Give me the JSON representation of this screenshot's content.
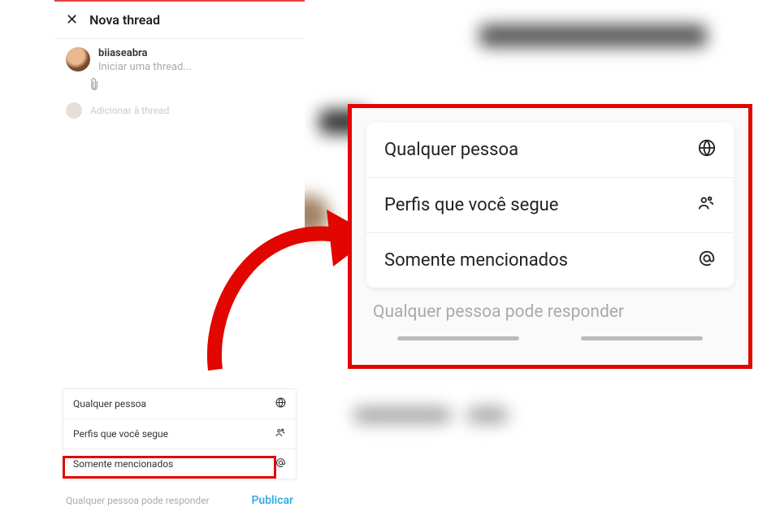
{
  "header": {
    "title": "Nova thread"
  },
  "compose": {
    "username": "biiaseabra",
    "placeholder": "Iniciar uma thread...",
    "add_thread": "Adicionar à thread"
  },
  "menu": {
    "items": [
      {
        "label": "Qualquer pessoa",
        "icon": "globe"
      },
      {
        "label": "Perfis que você segue",
        "icon": "people"
      },
      {
        "label": "Somente mencionados",
        "icon": "at"
      }
    ]
  },
  "footer": {
    "hint": "Qualquer pessoa pode responder",
    "publish": "Publicar"
  },
  "callout": {
    "hint": "Qualquer pessoa pode responder"
  }
}
